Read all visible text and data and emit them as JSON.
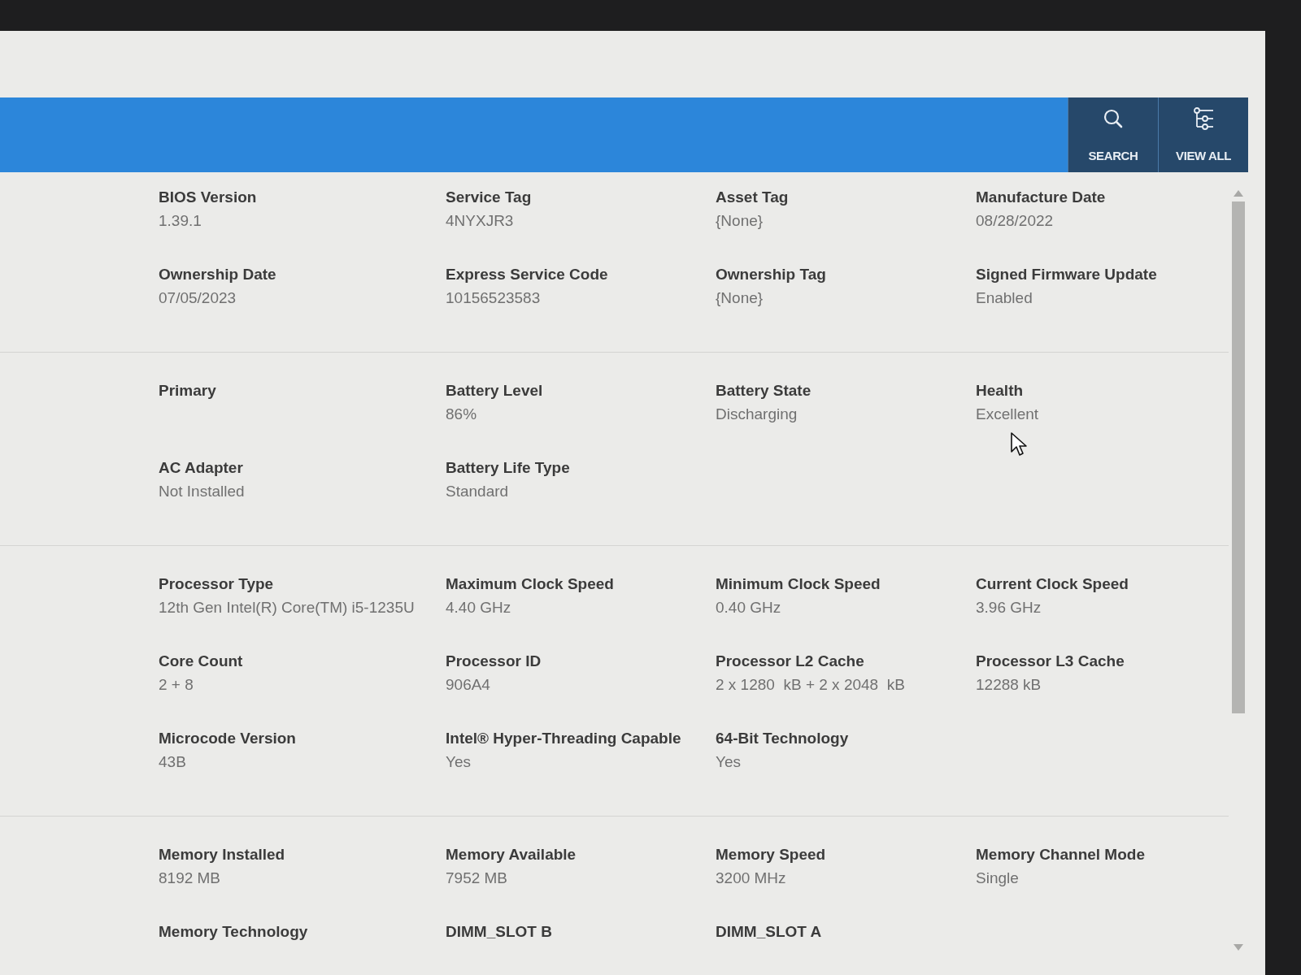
{
  "header": {
    "buttons": [
      {
        "kind": "search",
        "label": "SEARCH"
      },
      {
        "kind": "view_all",
        "label": "VIEW ALL"
      }
    ]
  },
  "sections": [
    {
      "rows": [
        [
          {
            "label": "BIOS Version",
            "value": "1.39.1"
          },
          {
            "label": "Service Tag",
            "value": "4NYXJR3"
          },
          {
            "label": "Asset Tag",
            "value": "{None}"
          },
          {
            "label": "Manufacture Date",
            "value": "08/28/2022"
          }
        ],
        [
          {
            "label": "Ownership Date",
            "value": "07/05/2023"
          },
          {
            "label": "Express Service Code",
            "value": "10156523583"
          },
          {
            "label": "Ownership Tag",
            "value": "{None}"
          },
          {
            "label": "Signed Firmware Update",
            "value": "Enabled"
          }
        ]
      ]
    },
    {
      "rows": [
        [
          {
            "label": "Primary"
          },
          {
            "label": "Battery Level",
            "value": "86%"
          },
          {
            "label": "Battery State",
            "value": "Discharging"
          },
          {
            "label": "Health",
            "value": "Excellent"
          }
        ],
        [
          {
            "label": "AC Adapter",
            "value": "Not Installed"
          },
          {
            "label": "Battery Life Type",
            "value": "Standard"
          }
        ]
      ]
    },
    {
      "rows": [
        [
          {
            "label": "Processor Type",
            "value": "12th Gen Intel(R) Core(TM) i5-1235U"
          },
          {
            "label": "Maximum Clock Speed",
            "value": "4.40 GHz"
          },
          {
            "label": "Minimum Clock Speed",
            "value": "0.40 GHz"
          },
          {
            "label": "Current Clock Speed",
            "value": "3.96 GHz"
          }
        ],
        [
          {
            "label": "Core Count",
            "value": "2 + 8"
          },
          {
            "label": "Processor ID",
            "value": "906A4"
          },
          {
            "label": "Processor L2 Cache",
            "value": "2 x 1280  kB + 2 x 2048  kB"
          },
          {
            "label": "Processor L3 Cache",
            "value": "12288 kB"
          }
        ],
        [
          {
            "label": "Microcode Version",
            "value": "43B"
          },
          {
            "label": "Intel® Hyper-Threading Capable",
            "value": "Yes"
          },
          {
            "label": "64-Bit Technology",
            "value": "Yes"
          }
        ]
      ]
    },
    {
      "rows": [
        [
          {
            "label": "Memory Installed",
            "value": "8192 MB"
          },
          {
            "label": "Memory Available",
            "value": "7952 MB"
          },
          {
            "label": "Memory Speed",
            "value": "3200 MHz"
          },
          {
            "label": "Memory Channel Mode",
            "value": "Single"
          }
        ],
        [
          {
            "label": "Memory Technology"
          },
          {
            "label": "DIMM_SLOT B"
          },
          {
            "label": "DIMM_SLOT A"
          }
        ]
      ]
    }
  ]
}
